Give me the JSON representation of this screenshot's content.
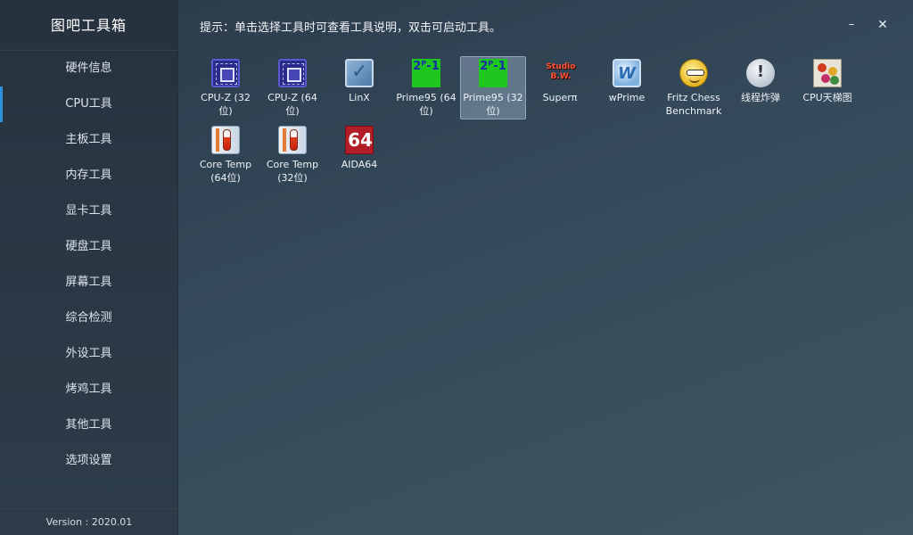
{
  "app": {
    "title": "图吧工具箱",
    "version": "Version : 2020.01",
    "hint": "提示：单击选择工具时可查看工具说明，双击可启动工具。",
    "window_controls": {
      "minimize": "–",
      "close": "✕"
    }
  },
  "sidebar": {
    "active_index": 1,
    "items": [
      {
        "label": "硬件信息"
      },
      {
        "label": "CPU工具"
      },
      {
        "label": "主板工具"
      },
      {
        "label": "内存工具"
      },
      {
        "label": "显卡工具"
      },
      {
        "label": "硬盘工具"
      },
      {
        "label": "屏幕工具"
      },
      {
        "label": "综合检测"
      },
      {
        "label": "外设工具"
      },
      {
        "label": "烤鸡工具"
      },
      {
        "label": "其他工具"
      },
      {
        "label": "选项设置"
      }
    ]
  },
  "tools": [
    {
      "label": "CPU-Z (32位)",
      "icon": "cpu-z-icon",
      "glyph": ""
    },
    {
      "label": "CPU-Z (64位)",
      "icon": "cpu-z-icon",
      "glyph": ""
    },
    {
      "label": "LinX",
      "icon": "linx-icon",
      "glyph": "✓"
    },
    {
      "label": "Prime95 (64位)",
      "icon": "prime95-icon",
      "glyph": "2ᴾ-1"
    },
    {
      "label": "Prime95 (32位)",
      "icon": "prime95-icon",
      "glyph": "2ᴾ-1",
      "selected": true
    },
    {
      "label": "Superπ",
      "icon": "superpi-icon",
      "glyph": "Studio B.W."
    },
    {
      "label": "wPrime",
      "icon": "wprime-icon",
      "glyph": "W"
    },
    {
      "label": "Fritz Chess Benchmark",
      "icon": "fritz-chess-icon",
      "glyph": ""
    },
    {
      "label": "线程炸弹",
      "icon": "warning-icon",
      "glyph": "!"
    },
    {
      "label": "CPU天梯图",
      "icon": "cpu-ladder-icon",
      "glyph": ""
    },
    {
      "label": "Core Temp (64位)",
      "icon": "core-temp-icon",
      "glyph": ""
    },
    {
      "label": "Core Temp (32位)",
      "icon": "core-temp-icon",
      "glyph": ""
    },
    {
      "label": "AIDA64",
      "icon": "aida64-icon",
      "glyph": "64"
    }
  ],
  "colors": {
    "accent": "#2f8fdc",
    "selected_bg": "#8ea4bd"
  }
}
